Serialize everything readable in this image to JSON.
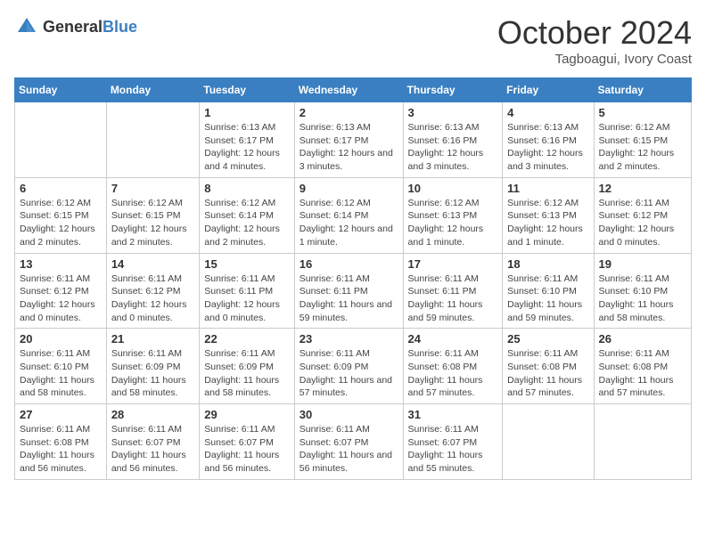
{
  "logo": {
    "text_general": "General",
    "text_blue": "Blue"
  },
  "title": {
    "month": "October 2024",
    "location": "Tagboagui, Ivory Coast"
  },
  "weekdays": [
    "Sunday",
    "Monday",
    "Tuesday",
    "Wednesday",
    "Thursday",
    "Friday",
    "Saturday"
  ],
  "weeks": [
    [
      {
        "day": "",
        "detail": ""
      },
      {
        "day": "",
        "detail": ""
      },
      {
        "day": "1",
        "detail": "Sunrise: 6:13 AM\nSunset: 6:17 PM\nDaylight: 12 hours and 4 minutes."
      },
      {
        "day": "2",
        "detail": "Sunrise: 6:13 AM\nSunset: 6:17 PM\nDaylight: 12 hours and 3 minutes."
      },
      {
        "day": "3",
        "detail": "Sunrise: 6:13 AM\nSunset: 6:16 PM\nDaylight: 12 hours and 3 minutes."
      },
      {
        "day": "4",
        "detail": "Sunrise: 6:13 AM\nSunset: 6:16 PM\nDaylight: 12 hours and 3 minutes."
      },
      {
        "day": "5",
        "detail": "Sunrise: 6:12 AM\nSunset: 6:15 PM\nDaylight: 12 hours and 2 minutes."
      }
    ],
    [
      {
        "day": "6",
        "detail": "Sunrise: 6:12 AM\nSunset: 6:15 PM\nDaylight: 12 hours and 2 minutes."
      },
      {
        "day": "7",
        "detail": "Sunrise: 6:12 AM\nSunset: 6:15 PM\nDaylight: 12 hours and 2 minutes."
      },
      {
        "day": "8",
        "detail": "Sunrise: 6:12 AM\nSunset: 6:14 PM\nDaylight: 12 hours and 2 minutes."
      },
      {
        "day": "9",
        "detail": "Sunrise: 6:12 AM\nSunset: 6:14 PM\nDaylight: 12 hours and 1 minute."
      },
      {
        "day": "10",
        "detail": "Sunrise: 6:12 AM\nSunset: 6:13 PM\nDaylight: 12 hours and 1 minute."
      },
      {
        "day": "11",
        "detail": "Sunrise: 6:12 AM\nSunset: 6:13 PM\nDaylight: 12 hours and 1 minute."
      },
      {
        "day": "12",
        "detail": "Sunrise: 6:11 AM\nSunset: 6:12 PM\nDaylight: 12 hours and 0 minutes."
      }
    ],
    [
      {
        "day": "13",
        "detail": "Sunrise: 6:11 AM\nSunset: 6:12 PM\nDaylight: 12 hours and 0 minutes."
      },
      {
        "day": "14",
        "detail": "Sunrise: 6:11 AM\nSunset: 6:12 PM\nDaylight: 12 hours and 0 minutes."
      },
      {
        "day": "15",
        "detail": "Sunrise: 6:11 AM\nSunset: 6:11 PM\nDaylight: 12 hours and 0 minutes."
      },
      {
        "day": "16",
        "detail": "Sunrise: 6:11 AM\nSunset: 6:11 PM\nDaylight: 11 hours and 59 minutes."
      },
      {
        "day": "17",
        "detail": "Sunrise: 6:11 AM\nSunset: 6:11 PM\nDaylight: 11 hours and 59 minutes."
      },
      {
        "day": "18",
        "detail": "Sunrise: 6:11 AM\nSunset: 6:10 PM\nDaylight: 11 hours and 59 minutes."
      },
      {
        "day": "19",
        "detail": "Sunrise: 6:11 AM\nSunset: 6:10 PM\nDaylight: 11 hours and 58 minutes."
      }
    ],
    [
      {
        "day": "20",
        "detail": "Sunrise: 6:11 AM\nSunset: 6:10 PM\nDaylight: 11 hours and 58 minutes."
      },
      {
        "day": "21",
        "detail": "Sunrise: 6:11 AM\nSunset: 6:09 PM\nDaylight: 11 hours and 58 minutes."
      },
      {
        "day": "22",
        "detail": "Sunrise: 6:11 AM\nSunset: 6:09 PM\nDaylight: 11 hours and 58 minutes."
      },
      {
        "day": "23",
        "detail": "Sunrise: 6:11 AM\nSunset: 6:09 PM\nDaylight: 11 hours and 57 minutes."
      },
      {
        "day": "24",
        "detail": "Sunrise: 6:11 AM\nSunset: 6:08 PM\nDaylight: 11 hours and 57 minutes."
      },
      {
        "day": "25",
        "detail": "Sunrise: 6:11 AM\nSunset: 6:08 PM\nDaylight: 11 hours and 57 minutes."
      },
      {
        "day": "26",
        "detail": "Sunrise: 6:11 AM\nSunset: 6:08 PM\nDaylight: 11 hours and 57 minutes."
      }
    ],
    [
      {
        "day": "27",
        "detail": "Sunrise: 6:11 AM\nSunset: 6:08 PM\nDaylight: 11 hours and 56 minutes."
      },
      {
        "day": "28",
        "detail": "Sunrise: 6:11 AM\nSunset: 6:07 PM\nDaylight: 11 hours and 56 minutes."
      },
      {
        "day": "29",
        "detail": "Sunrise: 6:11 AM\nSunset: 6:07 PM\nDaylight: 11 hours and 56 minutes."
      },
      {
        "day": "30",
        "detail": "Sunrise: 6:11 AM\nSunset: 6:07 PM\nDaylight: 11 hours and 56 minutes."
      },
      {
        "day": "31",
        "detail": "Sunrise: 6:11 AM\nSunset: 6:07 PM\nDaylight: 11 hours and 55 minutes."
      },
      {
        "day": "",
        "detail": ""
      },
      {
        "day": "",
        "detail": ""
      }
    ]
  ]
}
